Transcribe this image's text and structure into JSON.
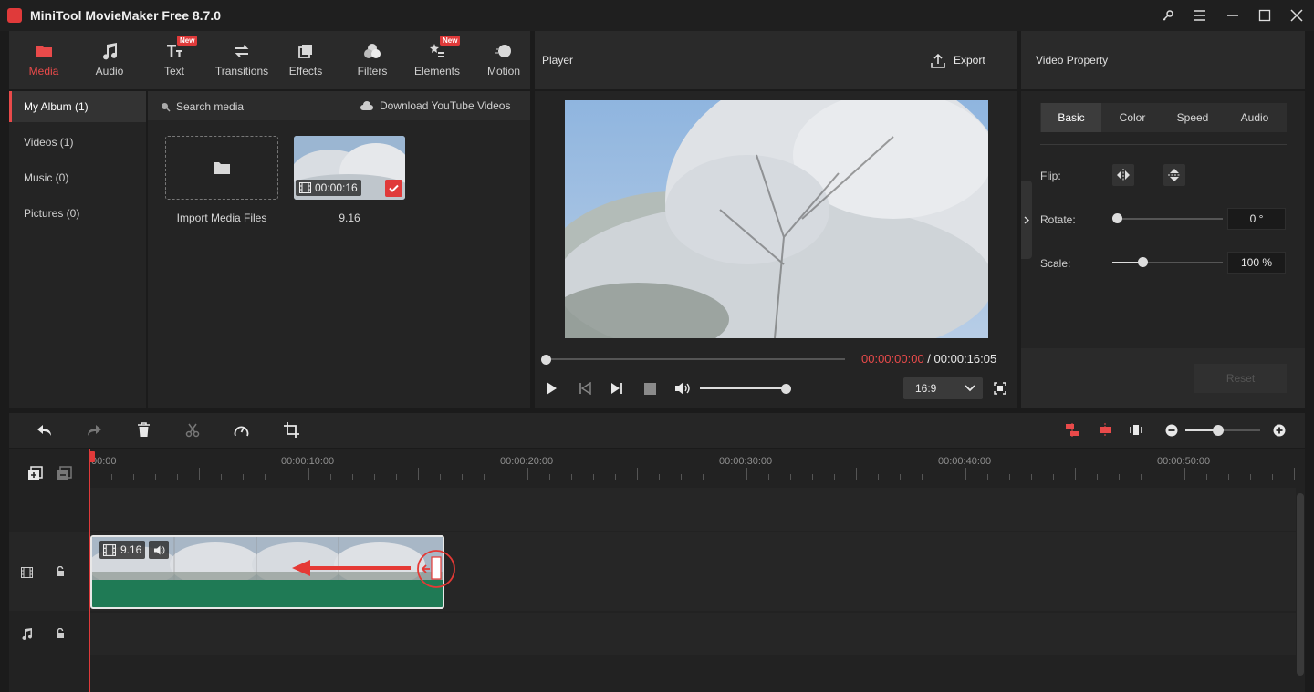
{
  "window": {
    "title": "MiniTool MovieMaker Free 8.7.0"
  },
  "toolbar": {
    "items": [
      {
        "label": "Media",
        "icon": "folder-icon",
        "active": true,
        "new": false
      },
      {
        "label": "Audio",
        "icon": "music-note-icon",
        "active": false,
        "new": false
      },
      {
        "label": "Text",
        "icon": "text-icon",
        "active": false,
        "new": true
      },
      {
        "label": "Transitions",
        "icon": "transitions-icon",
        "active": false,
        "new": false
      },
      {
        "label": "Effects",
        "icon": "effects-icon",
        "active": false,
        "new": false
      },
      {
        "label": "Filters",
        "icon": "filters-icon",
        "active": false,
        "new": false
      },
      {
        "label": "Elements",
        "icon": "elements-icon",
        "active": false,
        "new": true
      },
      {
        "label": "Motion",
        "icon": "motion-icon",
        "active": false,
        "new": false
      }
    ],
    "new_badge": "New"
  },
  "sidebar": {
    "items": [
      {
        "label": "My Album  (1)",
        "active": true
      },
      {
        "label": "Videos  (1)",
        "active": false
      },
      {
        "label": "Music  (0)",
        "active": false
      },
      {
        "label": "Pictures  (0)",
        "active": false
      }
    ]
  },
  "media": {
    "search_label": "Search media",
    "download_label": "Download YouTube Videos",
    "import_label": "Import Media Files",
    "clip_name": "9.16",
    "clip_duration": "00:00:16"
  },
  "player": {
    "title": "Player",
    "export_label": "Export",
    "current_time": "00:00:00:00",
    "separator": " / ",
    "total_time": "00:00:16:05",
    "aspect": "16:9",
    "progress": 0,
    "volume": 1.0
  },
  "property": {
    "title": "Video Property",
    "tabs": [
      "Basic",
      "Color",
      "Speed",
      "Audio"
    ],
    "active_tab": "Basic",
    "flip_label": "Flip:",
    "rotate_label": "Rotate:",
    "rotate_value": "0 °",
    "scale_label": "Scale:",
    "scale_value": "100 %",
    "reset_label": "Reset"
  },
  "timeline": {
    "ruler_labels": [
      "00:00",
      "00:00:10:00",
      "00:00:20:00",
      "00:00:30:00",
      "00:00:40:00",
      "00:00:50:00"
    ],
    "clip_name": "9.16",
    "zoom": 0.6
  },
  "colors": {
    "accent": "#e94a4a",
    "clip_green": "#1f7a55"
  }
}
